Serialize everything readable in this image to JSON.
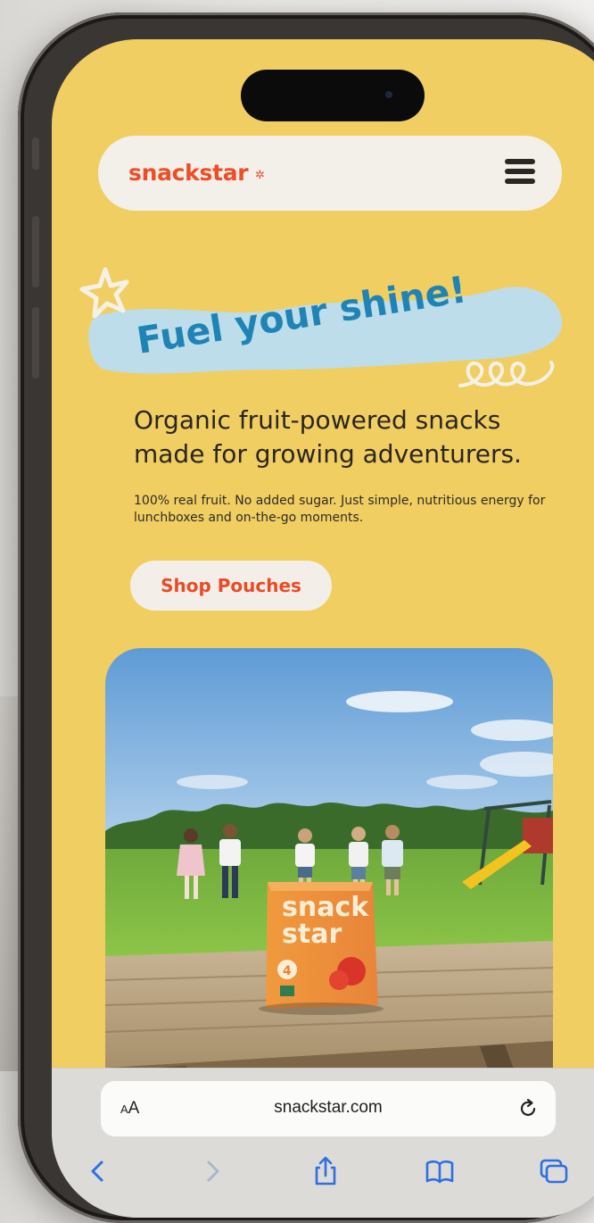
{
  "header": {
    "logo_text": "snackstar",
    "logo_star": "✲",
    "menu_icon": "hamburger-menu-icon"
  },
  "hero": {
    "headline": "Fuel your shine!",
    "tagline": "Organic fruit-powered snacks made for growing adventurers.",
    "subcopy": "100% real fruit. No added sugar. Just simple, nutritious energy for lunchboxes and on-the-go moments.",
    "cta_label": "Shop Pouches"
  },
  "product_photo": {
    "box_brand_line1": "snack",
    "box_brand_line2": "star",
    "box_count": "4"
  },
  "browser": {
    "text_size_label_small": "A",
    "text_size_label_large": "A",
    "url": "snackstar.com",
    "toolbar_icons": [
      "back-icon",
      "forward-icon",
      "share-icon",
      "bookmarks-icon",
      "tabs-icon"
    ]
  },
  "colors": {
    "page_bg": "#f1ce62",
    "brand_orange": "#ee4d25",
    "headline_blue": "#1f84b5",
    "wave_blue": "#bcdde9",
    "safari_accent": "#2f6fe0"
  }
}
